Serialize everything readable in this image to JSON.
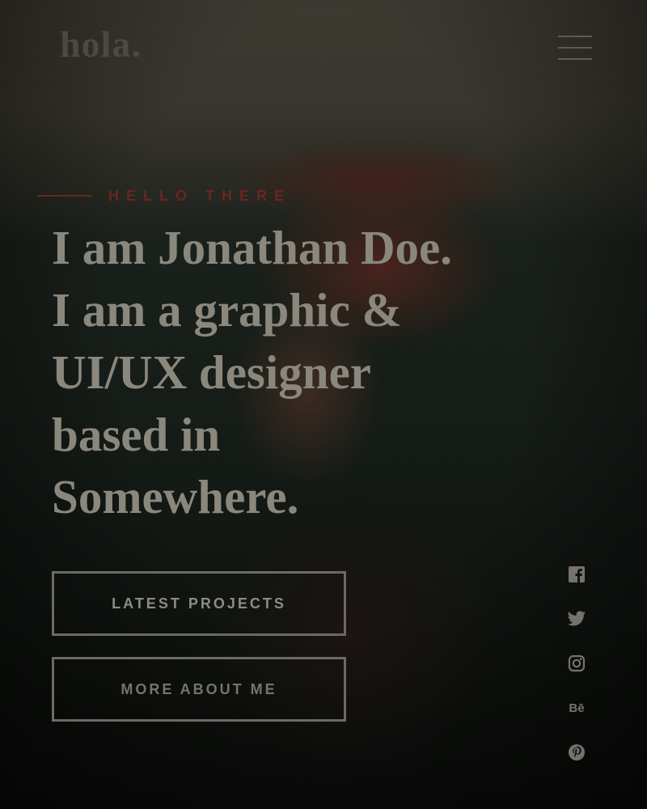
{
  "header": {
    "logo": "hola.",
    "menu_icon": "hamburger-menu-icon"
  },
  "hero": {
    "pretitle": "HELLO THERE",
    "headline_lines": [
      "I am Jonathan Doe.",
      "I am a graphic &",
      "UI/UX designer",
      "based in",
      "Somewhere."
    ],
    "buttons": {
      "latest_projects": "LATEST PROJECTS",
      "more_about_me": "MORE ABOUT ME"
    }
  },
  "social": [
    "facebook-icon",
    "twitter-icon",
    "instagram-icon",
    "behance-icon",
    "pinterest-icon"
  ],
  "colors": {
    "accent": "#6a2620",
    "text": "#8a877d",
    "border": "#6c6a62",
    "background": "#0b0c0b"
  }
}
